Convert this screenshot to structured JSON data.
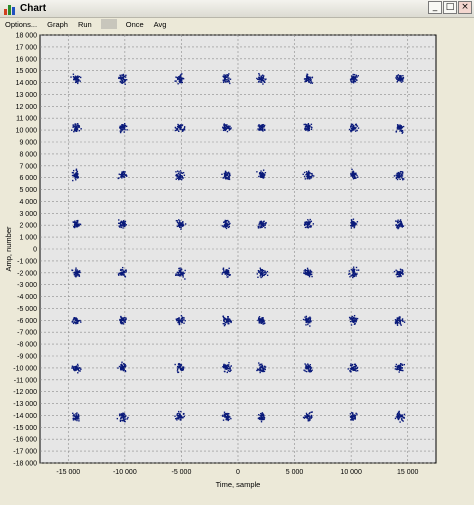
{
  "window": {
    "title": "Chart",
    "icon": "chart-app-icon",
    "buttons": {
      "minimize": "_",
      "maximize": "□",
      "close": "×"
    }
  },
  "menu": [
    {
      "label": "Options...",
      "name": "menu-options",
      "enabled": true
    },
    {
      "label": "Graph",
      "name": "menu-graph",
      "enabled": true
    },
    {
      "label": "Run",
      "name": "menu-run",
      "enabled": true
    },
    {
      "label": "",
      "name": "menu-disabled",
      "enabled": false
    },
    {
      "label": "Once",
      "name": "menu-once",
      "enabled": true
    },
    {
      "label": "Avg",
      "name": "menu-avg",
      "enabled": true
    }
  ],
  "colors": {
    "plot_background": "#e6e6e6",
    "grid": "#8c8c8c",
    "points": "#0a1a7a"
  },
  "chart_data": {
    "type": "scatter",
    "title": "",
    "xlabel": "Time, sample",
    "ylabel": "Amp, number",
    "xlim": [
      -17500,
      17500
    ],
    "ylim": [
      -18000,
      18000
    ],
    "grid": true,
    "x_ticks": [
      "-15 000",
      "-10 000",
      "-5 000",
      "0",
      "5 000",
      "10 000",
      "15 000"
    ],
    "y_ticks": [
      "18 000",
      "17 000",
      "16 000",
      "15 000",
      "14 000",
      "13 000",
      "12 000",
      "11 000",
      "10 000",
      "9 000",
      "8 000",
      "7 000",
      "6 000",
      "5 000",
      "4 000",
      "3 000",
      "2 000",
      "1 000",
      "0",
      "-1 000",
      "-2 000",
      "-3 000",
      "-4 000",
      "-5 000",
      "-6 000",
      "-7 000",
      "-8 000",
      "-9 000",
      "-10 000",
      "-11 000",
      "-12 000",
      "-13 000",
      "-14 000",
      "-15 000",
      "-16 000",
      "-17 000",
      "-18 000"
    ],
    "cluster_x": [
      -14300,
      -10200,
      -5100,
      -1000,
      2100,
      6200,
      10200,
      14300
    ],
    "cluster_y": [
      14300,
      10200,
      6200,
      2100,
      -2000,
      -6000,
      -10000,
      -14100
    ],
    "cluster_spread": 300
  }
}
